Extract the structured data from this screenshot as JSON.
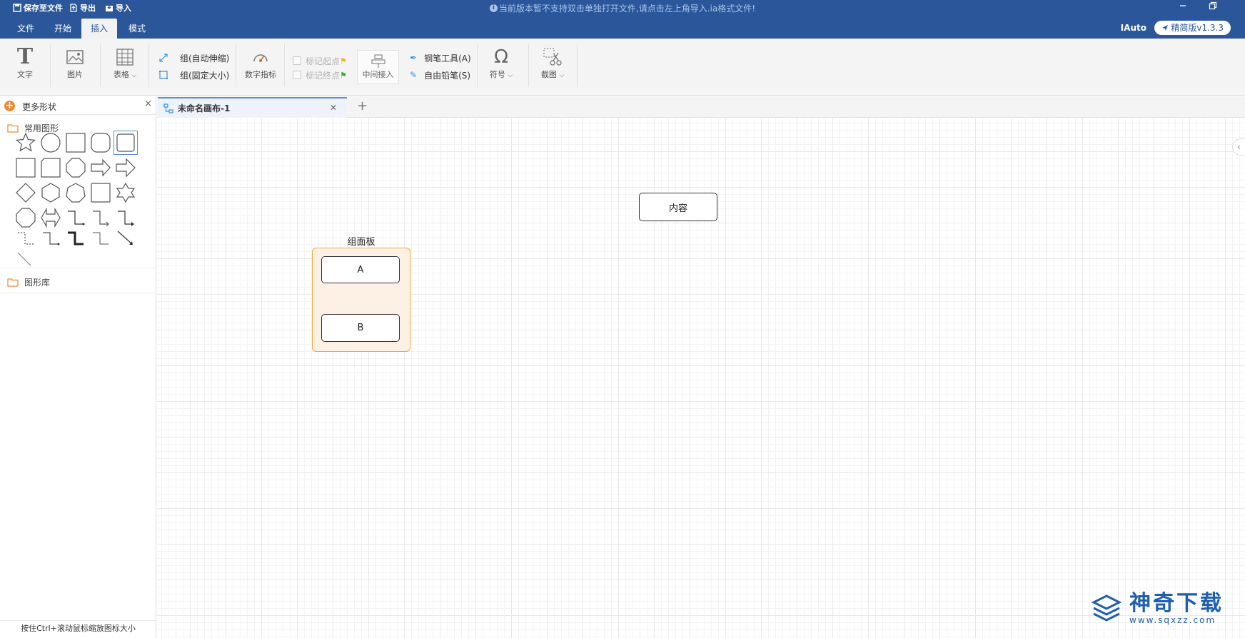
{
  "titlebar": {
    "save_to_file": "保存至文件",
    "export": "导出",
    "import": "导入",
    "notice": "当前版本暂不支持双击单独打开文件,请点击左上角导入.ia格式文件!"
  },
  "menu": {
    "tabs": [
      "文件",
      "开始",
      "插入",
      "模式"
    ],
    "active_tab": "插入",
    "user": "IAuto",
    "version": "精简版v1.3.3"
  },
  "ribbon": {
    "text": "文字",
    "image": "图片",
    "table": "表格",
    "group_auto": "组(自动伸缩)",
    "group_fixed": "组(固定大小)",
    "numeric_indicator": "数字指标",
    "mark_start": "标记起点",
    "mark_end": "标记终点",
    "middle_insert": "中间接入",
    "pen_tool": "钢笔工具(A)",
    "pencil": "自由铅笔(S)",
    "symbol": "符号",
    "screenshot": "截图"
  },
  "left_panel": {
    "title": "更多形状",
    "category_common": "常用图形",
    "category_library": "图形库",
    "hint": "按住Ctrl+滚动鼠标缩放图标大小"
  },
  "doc_tab": {
    "name": "未命名画布-1"
  },
  "canvas": {
    "panel_title": "组面板",
    "node_a": "A",
    "node_b": "B",
    "node_content": "内容"
  },
  "watermark": {
    "brand": "神奇下载",
    "url": "www.sqxzz.com"
  },
  "colors": {
    "accent": "#2b579a",
    "panel_border": "#f0a830",
    "panel_fill": "#fdf1e6",
    "orange": "#f0892b"
  }
}
